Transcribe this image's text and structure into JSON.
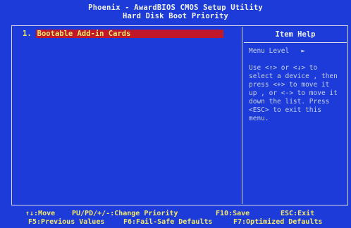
{
  "header": {
    "line1": "Phoenix - AwardBIOS CMOS Setup Utility",
    "line2": "Hard Disk Boot Priority"
  },
  "boot_list": [
    {
      "number": "1.",
      "label": "Bootable Add-in Cards",
      "selected": true
    }
  ],
  "help_panel": {
    "title": "Item Help",
    "menu_level_label": "Menu Level",
    "menu_level_marker": "►",
    "text": "Use <↑> or <↓> to\nselect a device , then\npress <+> to move it\nup , or <-> to move it\ndown the list. Press\n<ESC> to exit this\nmenu."
  },
  "footer": {
    "row1": {
      "move": "↑↓:Move",
      "change_priority": "PU/PD/+/-:Change Priority",
      "save": "F10:Save",
      "exit": "ESC:Exit"
    },
    "row2": {
      "previous_values": "F5:Previous Values",
      "fail_safe": "F6:Fail-Safe Defaults",
      "optimized": "F7:Optimized Defaults"
    }
  },
  "colors": {
    "background": "#1c3bd8",
    "highlight": "#c0182a",
    "highlight_text": "#f7e86e",
    "help_text": "#c8d0f0"
  }
}
